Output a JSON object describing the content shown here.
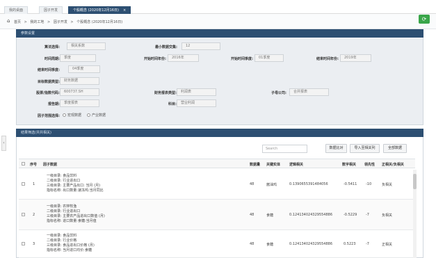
{
  "tabs": [
    {
      "label": "我的桌面",
      "active": false
    },
    {
      "label": "因子开发",
      "active": false
    },
    {
      "label": "个股概念 (2020年12月16日)",
      "active": true
    }
  ],
  "breadcrumb": {
    "home_icon": "home-icon",
    "items": [
      "首页",
      ">",
      "我的工地",
      ">",
      "因子开发",
      ">",
      "个股概念 (2020年12月16日)"
    ]
  },
  "refresh": {
    "icon": "refresh-icon",
    "glyph": "⟳"
  },
  "params_panel": {
    "title": "参数设置",
    "fields": {
      "algorithm": {
        "label": "算法选择:",
        "value": "相关系数"
      },
      "min_samples": {
        "label": "最小数据交集:",
        "value": "12"
      },
      "period": {
        "label": "时间周期:",
        "value": "季度"
      },
      "start_year": {
        "label": "开始时间年份:",
        "value": "2016年"
      },
      "start_quarter": {
        "label": "开始时间季度:",
        "value": "01季度"
      },
      "end_year": {
        "label": "结束时间年份:",
        "value": "2019年"
      },
      "end_quarter": {
        "label": "结束时间季度:",
        "value": "04季度"
      },
      "target_type": {
        "label": "目标数据类型:",
        "value": "财务数据"
      },
      "stock_code": {
        "label": "股票/指数代码:",
        "value": "600737.SH"
      },
      "report_type": {
        "label": "财务报表类型:",
        "value": "利润表"
      },
      "sub_company": {
        "label": "子母公司:",
        "value": "合并报表"
      },
      "report_period": {
        "label": "报告期:",
        "value": "季度报表"
      },
      "item": {
        "label": "科目:",
        "value": "营业利润"
      },
      "factor_range": {
        "label": "因子范围选择:",
        "options": [
          "宏观数据",
          "产业数据"
        ]
      }
    }
  },
  "results_panel": {
    "title": "结果筛选(共共相关)",
    "search_placeholder": "Search",
    "buttons": [
      "数据比对",
      "导入至相关列",
      "全部数据"
    ],
    "columns": [
      "序号",
      "因子数据",
      "数据量",
      "关键实体",
      "逻辑相关",
      "数字相关",
      "领先性",
      "正相关/负相关"
    ],
    "rows": [
      {
        "index": "1",
        "factor": [
          "一级目录: 食品饮料",
          "二级目录: 行业进出口",
          "三级目录: 主要产品出口: 当月 (月)",
          "指标名称: 出口数量:速冻鸡:当月同比"
        ],
        "count": "48",
        "entity": "酱油鸡",
        "logic": "0.1390655391484056",
        "num": "-0.5411",
        "lead": "-10",
        "direction": "负相关"
      },
      {
        "index": "2",
        "factor": [
          "一级目录: 农林牧渔",
          "二级目录: 行业进出口",
          "三级目录: 主要农产品进出口数值 (月)",
          "指标名称: 进口数量:食糖:当月值"
        ],
        "count": "48",
        "entity": "食糖",
        "logic": "0.124134024329554886",
        "num": "-0.5229",
        "lead": "-7",
        "direction": "负相关"
      },
      {
        "index": "3",
        "factor": [
          "一级目录: 食品饮料",
          "二级目录: 行业价格",
          "三级目录: 食品进出口价格 (月)",
          "指标名称: 当月进口均价:食糖"
        ],
        "count": "48",
        "entity": "食糖",
        "logic": "0.124134024329554886",
        "num": "0.5223",
        "lead": "-7",
        "direction": "正相关"
      }
    ]
  }
}
